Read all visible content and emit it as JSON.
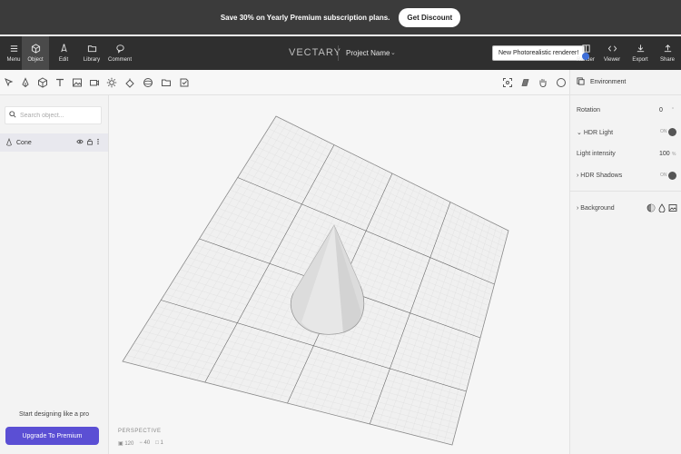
{
  "promo": {
    "text": "Save 30% on Yearly Premium subscription plans.",
    "button": "Get Discount"
  },
  "topbar": {
    "tools_left": [
      {
        "label": "Menu",
        "icon": "menu-icon"
      },
      {
        "label": "Object",
        "icon": "cube-icon"
      },
      {
        "label": "Edit",
        "icon": "edit-icon"
      },
      {
        "label": "Library",
        "icon": "folder-icon"
      },
      {
        "label": "Comment",
        "icon": "comment-icon"
      }
    ],
    "brand": "VECTARY",
    "project_name": "Project Name",
    "tooltip": "New Photorealistic renderer!",
    "tools_right": [
      {
        "label": "Render",
        "icon": "render-icon"
      },
      {
        "label": "Viewer",
        "icon": "code-icon"
      },
      {
        "label": "Export",
        "icon": "download-icon"
      },
      {
        "label": "Share",
        "icon": "upload-icon"
      }
    ]
  },
  "left_panel": {
    "search_placeholder": "Search object...",
    "objects": [
      {
        "name": "Cone"
      }
    ],
    "promo_text": "Start designing like a pro",
    "upgrade_button": "Upgrade To Premium"
  },
  "viewport": {
    "camera": "PERSPECTIVE",
    "stats": [
      {
        "icon": "vertex-icon",
        "value": "120"
      },
      {
        "icon": "edge-icon",
        "value": "40"
      },
      {
        "icon": "face-icon",
        "value": "1"
      }
    ]
  },
  "right_panel": {
    "title": "Environment",
    "rotation_label": "Rotation",
    "rotation_value": "0",
    "hdr_light_label": "HDR Light",
    "hdr_light_state": "ON",
    "light_intensity_label": "Light intensity",
    "light_intensity_value": "100",
    "light_intensity_unit": "%",
    "hdr_shadows_label": "HDR Shadows",
    "hdr_shadows_state": "ON",
    "background_label": "Background"
  },
  "colors": {
    "accent": "#5b4fd4",
    "render_dot": "#3f6fd8",
    "topbar": "#2f2f2f",
    "banner": "#3b3b3b"
  }
}
